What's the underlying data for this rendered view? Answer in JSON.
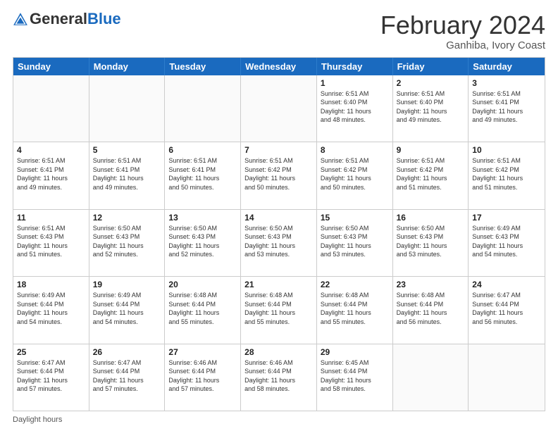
{
  "logo": {
    "general": "General",
    "blue": "Blue"
  },
  "title": "February 2024",
  "location": "Ganhiba, Ivory Coast",
  "days_of_week": [
    "Sunday",
    "Monday",
    "Tuesday",
    "Wednesday",
    "Thursday",
    "Friday",
    "Saturday"
  ],
  "footer": "Daylight hours",
  "weeks": [
    [
      {
        "day": "",
        "info": ""
      },
      {
        "day": "",
        "info": ""
      },
      {
        "day": "",
        "info": ""
      },
      {
        "day": "",
        "info": ""
      },
      {
        "day": "1",
        "info": "Sunrise: 6:51 AM\nSunset: 6:40 PM\nDaylight: 11 hours\nand 48 minutes."
      },
      {
        "day": "2",
        "info": "Sunrise: 6:51 AM\nSunset: 6:40 PM\nDaylight: 11 hours\nand 49 minutes."
      },
      {
        "day": "3",
        "info": "Sunrise: 6:51 AM\nSunset: 6:41 PM\nDaylight: 11 hours\nand 49 minutes."
      }
    ],
    [
      {
        "day": "4",
        "info": "Sunrise: 6:51 AM\nSunset: 6:41 PM\nDaylight: 11 hours\nand 49 minutes."
      },
      {
        "day": "5",
        "info": "Sunrise: 6:51 AM\nSunset: 6:41 PM\nDaylight: 11 hours\nand 49 minutes."
      },
      {
        "day": "6",
        "info": "Sunrise: 6:51 AM\nSunset: 6:41 PM\nDaylight: 11 hours\nand 50 minutes."
      },
      {
        "day": "7",
        "info": "Sunrise: 6:51 AM\nSunset: 6:42 PM\nDaylight: 11 hours\nand 50 minutes."
      },
      {
        "day": "8",
        "info": "Sunrise: 6:51 AM\nSunset: 6:42 PM\nDaylight: 11 hours\nand 50 minutes."
      },
      {
        "day": "9",
        "info": "Sunrise: 6:51 AM\nSunset: 6:42 PM\nDaylight: 11 hours\nand 51 minutes."
      },
      {
        "day": "10",
        "info": "Sunrise: 6:51 AM\nSunset: 6:42 PM\nDaylight: 11 hours\nand 51 minutes."
      }
    ],
    [
      {
        "day": "11",
        "info": "Sunrise: 6:51 AM\nSunset: 6:43 PM\nDaylight: 11 hours\nand 51 minutes."
      },
      {
        "day": "12",
        "info": "Sunrise: 6:50 AM\nSunset: 6:43 PM\nDaylight: 11 hours\nand 52 minutes."
      },
      {
        "day": "13",
        "info": "Sunrise: 6:50 AM\nSunset: 6:43 PM\nDaylight: 11 hours\nand 52 minutes."
      },
      {
        "day": "14",
        "info": "Sunrise: 6:50 AM\nSunset: 6:43 PM\nDaylight: 11 hours\nand 53 minutes."
      },
      {
        "day": "15",
        "info": "Sunrise: 6:50 AM\nSunset: 6:43 PM\nDaylight: 11 hours\nand 53 minutes."
      },
      {
        "day": "16",
        "info": "Sunrise: 6:50 AM\nSunset: 6:43 PM\nDaylight: 11 hours\nand 53 minutes."
      },
      {
        "day": "17",
        "info": "Sunrise: 6:49 AM\nSunset: 6:43 PM\nDaylight: 11 hours\nand 54 minutes."
      }
    ],
    [
      {
        "day": "18",
        "info": "Sunrise: 6:49 AM\nSunset: 6:44 PM\nDaylight: 11 hours\nand 54 minutes."
      },
      {
        "day": "19",
        "info": "Sunrise: 6:49 AM\nSunset: 6:44 PM\nDaylight: 11 hours\nand 54 minutes."
      },
      {
        "day": "20",
        "info": "Sunrise: 6:48 AM\nSunset: 6:44 PM\nDaylight: 11 hours\nand 55 minutes."
      },
      {
        "day": "21",
        "info": "Sunrise: 6:48 AM\nSunset: 6:44 PM\nDaylight: 11 hours\nand 55 minutes."
      },
      {
        "day": "22",
        "info": "Sunrise: 6:48 AM\nSunset: 6:44 PM\nDaylight: 11 hours\nand 55 minutes."
      },
      {
        "day": "23",
        "info": "Sunrise: 6:48 AM\nSunset: 6:44 PM\nDaylight: 11 hours\nand 56 minutes."
      },
      {
        "day": "24",
        "info": "Sunrise: 6:47 AM\nSunset: 6:44 PM\nDaylight: 11 hours\nand 56 minutes."
      }
    ],
    [
      {
        "day": "25",
        "info": "Sunrise: 6:47 AM\nSunset: 6:44 PM\nDaylight: 11 hours\nand 57 minutes."
      },
      {
        "day": "26",
        "info": "Sunrise: 6:47 AM\nSunset: 6:44 PM\nDaylight: 11 hours\nand 57 minutes."
      },
      {
        "day": "27",
        "info": "Sunrise: 6:46 AM\nSunset: 6:44 PM\nDaylight: 11 hours\nand 57 minutes."
      },
      {
        "day": "28",
        "info": "Sunrise: 6:46 AM\nSunset: 6:44 PM\nDaylight: 11 hours\nand 58 minutes."
      },
      {
        "day": "29",
        "info": "Sunrise: 6:45 AM\nSunset: 6:44 PM\nDaylight: 11 hours\nand 58 minutes."
      },
      {
        "day": "",
        "info": ""
      },
      {
        "day": "",
        "info": ""
      }
    ]
  ]
}
